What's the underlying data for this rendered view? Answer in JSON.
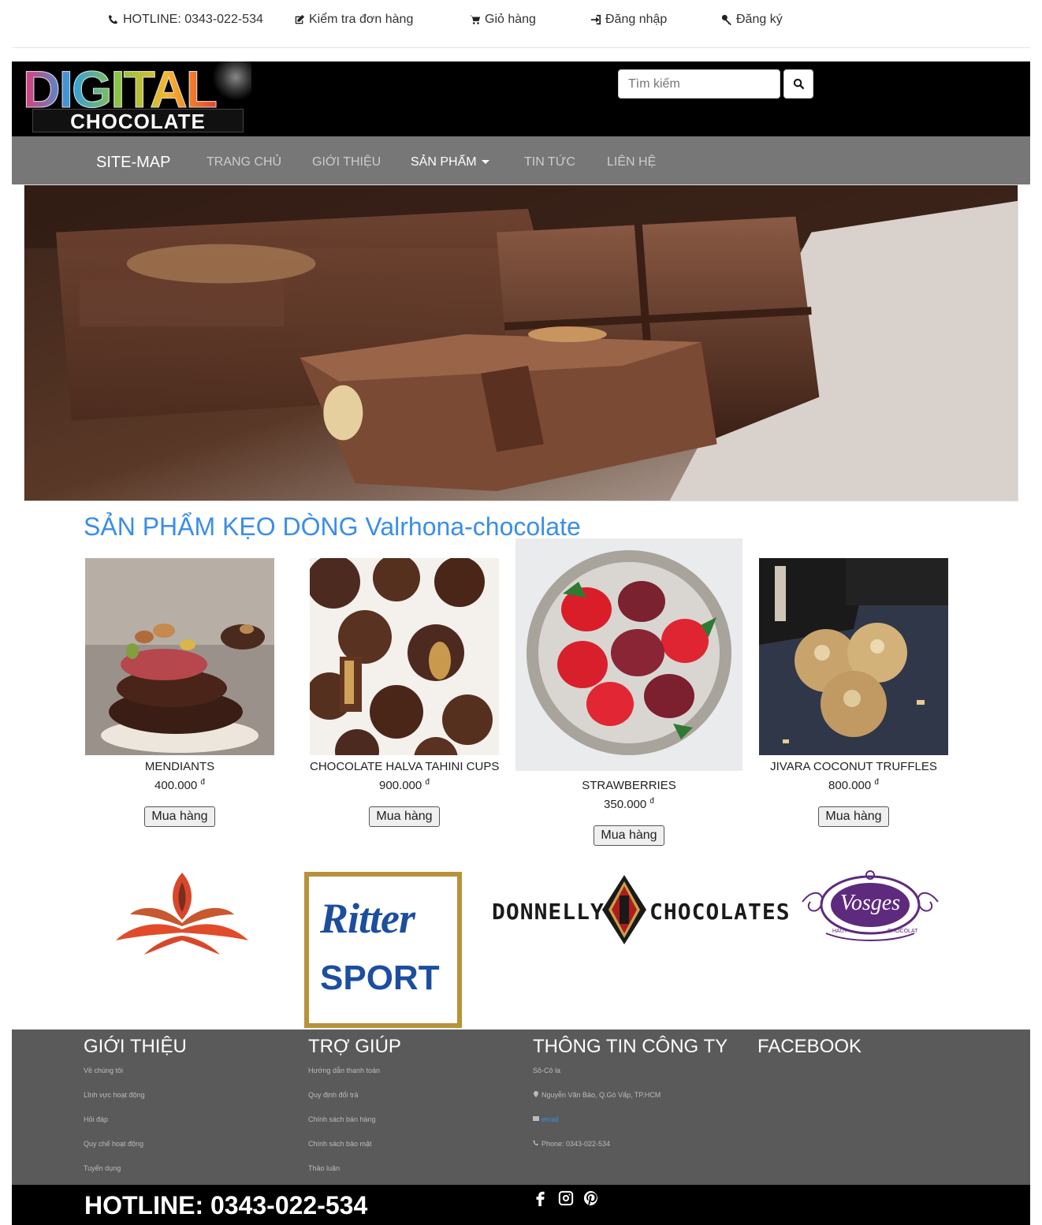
{
  "topbar": {
    "hotline": "HOTLINE: 0343-022-534",
    "check_order": "Kiểm tra đơn hàng",
    "cart": "Giỏ hàng",
    "login": "Đăng nhập",
    "register": "Đăng ký"
  },
  "header": {
    "logo_top": "DIGITAL",
    "logo_bottom": "CHOCOLATE",
    "search_placeholder": "Tìm kiếm"
  },
  "nav": {
    "brand": "SITE-MAP",
    "items": [
      "TRANG CHỦ",
      "GIỚI THIỆU",
      "SẢN PHẨM",
      "TIN TỨC",
      "LIÊN HỆ"
    ]
  },
  "section_title": "SẢN PHẨM KẸO DÒNG Valrhona-chocolate",
  "products": [
    {
      "name": "MENDIANTS",
      "price": "400.000",
      "currency": "đ",
      "button": "Mua hàng"
    },
    {
      "name": "CHOCOLATE HALVA TAHINI CUPS",
      "price": "900.000",
      "currency": "đ",
      "button": "Mua hàng"
    },
    {
      "name": "STRAWBERRIES",
      "price": "350.000",
      "currency": "đ",
      "button": "Mua hàng"
    },
    {
      "name": "JIVARA COCONUT TRUFFLES",
      "price": "800.000",
      "currency": "đ",
      "button": "Mua hàng"
    }
  ],
  "brands": {
    "ritter_line1": "Ritter",
    "ritter_line2": "SPORT",
    "donnelly_left": "DONNELLY",
    "donnelly_right": "CHOCOLATES",
    "vosges": "Vosges",
    "vosges_sub_left": "HAUT",
    "vosges_sub_right": "CHOCOLAT"
  },
  "footer": {
    "col1": {
      "title": "GIỚI THIỆU",
      "links": [
        "Về chúng tôi",
        "Lĩnh vực hoạt động",
        "Hỏi đáp",
        "Quy chế hoạt động",
        "Tuyển dụng"
      ]
    },
    "col2": {
      "title": "TRỢ GIÚP",
      "links": [
        "Hướng dẫn thanh toán",
        "Quy định đổi trả",
        "Chính sách bán hàng",
        "Chính sách bảo mật",
        "Thảo luận"
      ]
    },
    "col3": {
      "title": "THÔNG TIN CÔNG TY",
      "company": "Sô-Cô la",
      "address": "Nguyễn Văn Bảo, Q.Gò Vấp, TP.HCM",
      "email": "email",
      "phone": "Phone: 0343-022-534"
    },
    "col4": {
      "title": "FACEBOOK"
    },
    "hotline": "HOTLINE: 0343-022-534"
  },
  "icons": [
    "phone-icon",
    "edit-icon",
    "cart-icon",
    "sign-in-icon",
    "key-icon",
    "search-icon",
    "map-marker-icon",
    "envelope-icon",
    "facebook-icon",
    "instagram-icon",
    "pinterest-icon"
  ]
}
